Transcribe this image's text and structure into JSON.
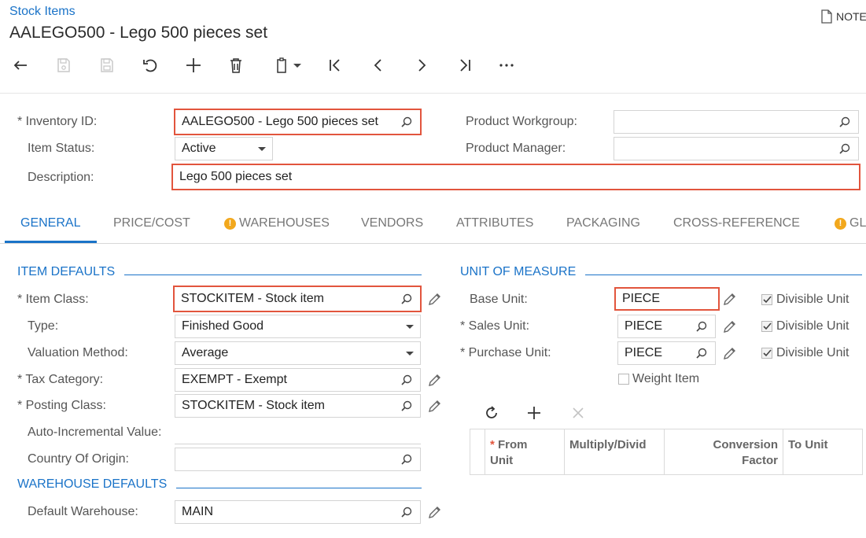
{
  "header": {
    "breadcrumb": "Stock Items",
    "title": "AALEGO500 - Lego 500 pieces set",
    "notes": "NOTE"
  },
  "toolbar": {
    "buttons": [
      "back",
      "save-disabled",
      "save-close-disabled",
      "undo",
      "add",
      "delete",
      "copy-paste",
      "first",
      "previous",
      "next",
      "last",
      "more"
    ]
  },
  "summary": {
    "inventory_id_label": "Inventory ID:",
    "inventory_id_value": "AALEGO500 - Lego 500 pieces set",
    "item_status_label": "Item Status:",
    "item_status_value": "Active",
    "description_label": "Description:",
    "description_value": "Lego 500 pieces set",
    "product_workgroup_label": "Product Workgroup:",
    "product_workgroup_value": "",
    "product_manager_label": "Product Manager:",
    "product_manager_value": ""
  },
  "tabs": [
    {
      "label": "GENERAL",
      "warning": false
    },
    {
      "label": "PRICE/COST",
      "warning": false
    },
    {
      "label": "WAREHOUSES",
      "warning": true
    },
    {
      "label": "VENDORS",
      "warning": false
    },
    {
      "label": "ATTRIBUTES",
      "warning": false
    },
    {
      "label": "PACKAGING",
      "warning": false
    },
    {
      "label": "CROSS-REFERENCE",
      "warning": false
    },
    {
      "label": "GL",
      "warning": true
    }
  ],
  "item_defaults": {
    "section": "ITEM DEFAULTS",
    "item_class_label": "Item Class:",
    "item_class_value": "STOCKITEM - Stock item",
    "type_label": "Type:",
    "type_value": "Finished Good",
    "valuation_label": "Valuation Method:",
    "valuation_value": "Average",
    "tax_category_label": "Tax Category:",
    "tax_category_value": "EXEMPT - Exempt",
    "posting_class_label": "Posting Class:",
    "posting_class_value": "STOCKITEM - Stock item",
    "auto_incremental_label": "Auto-Incremental Value:",
    "country_label": "Country Of Origin:",
    "country_value": ""
  },
  "warehouse_defaults": {
    "section": "WAREHOUSE DEFAULTS",
    "default_warehouse_label": "Default Warehouse:",
    "default_warehouse_value": "MAIN"
  },
  "unit_of_measure": {
    "section": "UNIT OF MEASURE",
    "base_unit_label": "Base Unit:",
    "base_unit_value": "PIECE",
    "sales_unit_label": "Sales Unit:",
    "sales_unit_value": "PIECE",
    "purchase_unit_label": "Purchase Unit:",
    "purchase_unit_value": "PIECE",
    "divisible_unit_label": "Divisible Unit",
    "weight_item_label": "Weight Item"
  },
  "conversion_grid": {
    "columns": [
      "From Unit",
      "Multiply/Divid",
      "Conversion Factor",
      "To Unit"
    ],
    "from_unit_line1": "From",
    "from_unit_line2": "Unit",
    "conversion_line1": "Conversion",
    "conversion_line2": "Factor"
  },
  "colors": {
    "accent": "#1a73c8",
    "highlight": "#e2553d",
    "warning": "#f2a81d"
  }
}
